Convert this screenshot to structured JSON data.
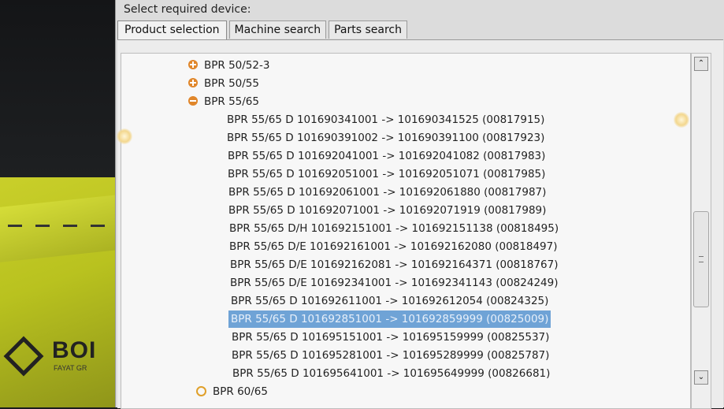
{
  "header": {
    "device_label": "Select required device:"
  },
  "tabs": [
    {
      "label": "Product selection",
      "active": true
    },
    {
      "label": "Machine search",
      "active": false
    },
    {
      "label": "Parts search",
      "active": false
    }
  ],
  "tree": {
    "nodes": [
      {
        "label": "BPR 50/52-3",
        "state": "collapsed",
        "icon": "expand-icon"
      },
      {
        "label": "BPR 50/55",
        "state": "collapsed",
        "icon": "expand-icon"
      },
      {
        "label": "BPR 55/65",
        "state": "expanded",
        "icon": "collapse-icon"
      }
    ],
    "leaves": [
      "BPR 55/65 D 101690341001  -> 101690341525 (00817915)",
      "BPR 55/65 D 101690391002  -> 101690391100 (00817923)",
      "BPR 55/65 D 101692041001  -> 101692041082 (00817983)",
      "BPR 55/65 D 101692051001  -> 101692051071 (00817985)",
      "BPR 55/65 D 101692061001  -> 101692061880 (00817987)",
      "BPR 55/65 D 101692071001  -> 101692071919 (00817989)",
      "BPR 55/65 D/H 101692151001  -> 101692151138 (00818495)",
      "BPR 55/65 D/E 101692161001  -> 101692162080 (00818497)",
      "BPR 55/65 D/E 101692162081  -> 101692164371 (00818767)",
      "BPR 55/65 D/E 101692341001  -> 101692341143 (00824249)",
      "BPR 55/65 D 101692611001  -> 101692612054 (00824325)",
      "BPR 55/65 D 101692851001  -> 101692859999 (00825009)",
      "BPR 55/65 D 101695151001  -> 101695159999 (00825537)",
      "BPR 55/65 D 101695281001  -> 101695289999 (00825787)",
      "BPR 55/65 D 101695641001  -> 101695649999 (00826681)"
    ],
    "selected_index": 11,
    "last_node": {
      "label": "BPR 60/65",
      "icon": "hollow-node-icon"
    }
  },
  "scrollbar": {
    "up_glyph": "⌃",
    "down_glyph": "⌄"
  },
  "brand": {
    "logo_text": "BOI",
    "logo_sub": "FAYAT GR"
  },
  "colors": {
    "accent_node": "#e0862a",
    "selection": "#6fa3d6"
  }
}
